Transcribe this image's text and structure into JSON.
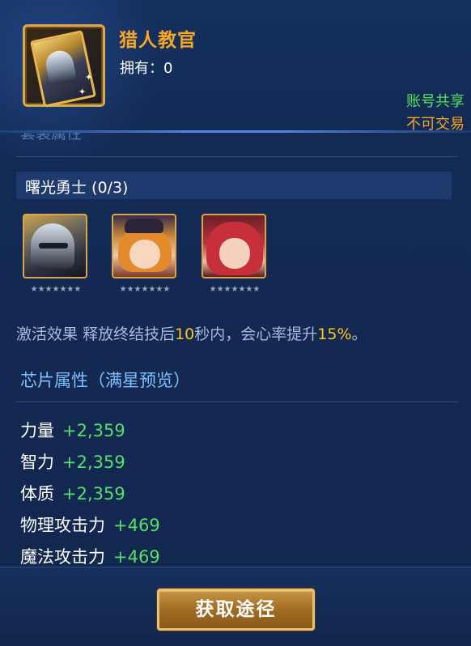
{
  "item": {
    "title": "猎人教官",
    "owned_label": "拥有：",
    "owned_count": "0",
    "tag_shared": "账号共享",
    "tag_trade": "不可交易"
  },
  "sections": {
    "cut_heading": "套装属性"
  },
  "set": {
    "name": "曙光勇士 (0/3)",
    "members": [
      {
        "stars": "★★★★★★★"
      },
      {
        "stars": "★★★★★★★"
      },
      {
        "stars": "★★★★★★★"
      }
    ],
    "effect": {
      "label": "激活效果",
      "part1": "释放终结技后",
      "seconds": "10",
      "part2": "秒内，会心率提升",
      "percent": "15%",
      "part3": "。"
    }
  },
  "chip": {
    "title": "芯片属性（满星预览）",
    "attributes": [
      {
        "name": "力量",
        "value": "+2,359"
      },
      {
        "name": "智力",
        "value": "+2,359"
      },
      {
        "name": "体质",
        "value": "+2,359"
      },
      {
        "name": "物理攻击力",
        "value": "+469"
      },
      {
        "name": "魔法攻击力",
        "value": "+469"
      }
    ]
  },
  "footer": {
    "button_label": "获取途径"
  },
  "colors": {
    "title": "#f5a623",
    "positive": "#55e06a",
    "highlight": "#ffc51e",
    "section_title": "#7ec0ff",
    "background": "#142a57"
  }
}
